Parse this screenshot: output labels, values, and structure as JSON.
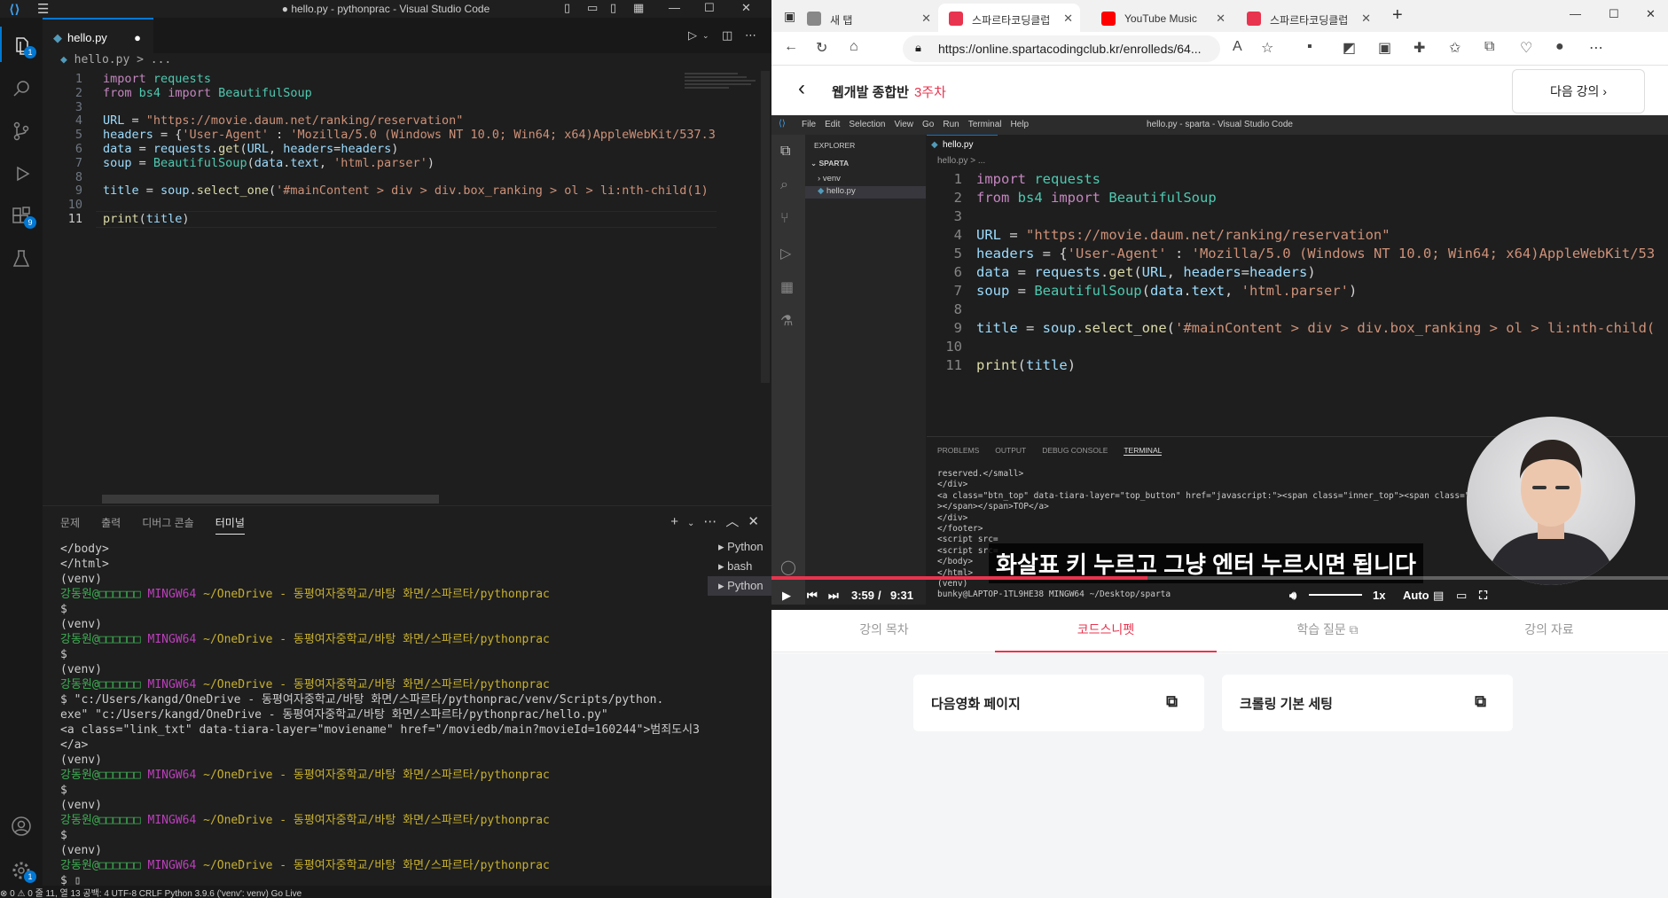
{
  "vscode": {
    "window_title": "● hello.py - pythonprac - Visual Studio Code",
    "badges": {
      "explorer": "1",
      "extensions": "9",
      "settings": "1"
    },
    "tab": {
      "label": "hello.py",
      "modified_dot": "●"
    },
    "breadcrumb": "hello.py > ...",
    "line_numbers": [
      "1",
      "2",
      "3",
      "4",
      "5",
      "6",
      "7",
      "8",
      "9",
      "10",
      "11"
    ],
    "current_line": "11",
    "code": [
      [
        {
          "t": "import",
          "c": "kw"
        },
        {
          "t": " "
        },
        {
          "t": "requests",
          "c": "mod"
        }
      ],
      [
        {
          "t": "from",
          "c": "kw"
        },
        {
          "t": " "
        },
        {
          "t": "bs4",
          "c": "mod"
        },
        {
          "t": " "
        },
        {
          "t": "import",
          "c": "kw"
        },
        {
          "t": " "
        },
        {
          "t": "BeautifulSoup",
          "c": "mod"
        }
      ],
      [],
      [
        {
          "t": "URL",
          "c": "var"
        },
        {
          "t": " = "
        },
        {
          "t": "\"https://movie.daum.net/ranking/reservation\"",
          "c": "str"
        }
      ],
      [
        {
          "t": "headers",
          "c": "var"
        },
        {
          "t": " = {"
        },
        {
          "t": "'User-Agent'",
          "c": "str"
        },
        {
          "t": " : "
        },
        {
          "t": "'Mozilla/5.0 (Windows NT 10.0; Win64; x64)AppleWebKit/537.3",
          "c": "str"
        }
      ],
      [
        {
          "t": "data",
          "c": "var"
        },
        {
          "t": " = "
        },
        {
          "t": "requests",
          "c": "var"
        },
        {
          "t": "."
        },
        {
          "t": "get",
          "c": "fn"
        },
        {
          "t": "("
        },
        {
          "t": "URL",
          "c": "var"
        },
        {
          "t": ", "
        },
        {
          "t": "headers",
          "c": "var"
        },
        {
          "t": "="
        },
        {
          "t": "headers",
          "c": "var"
        },
        {
          "t": ")"
        }
      ],
      [
        {
          "t": "soup",
          "c": "var"
        },
        {
          "t": " = "
        },
        {
          "t": "BeautifulSoup",
          "c": "mod"
        },
        {
          "t": "("
        },
        {
          "t": "data",
          "c": "var"
        },
        {
          "t": "."
        },
        {
          "t": "text",
          "c": "var"
        },
        {
          "t": ", "
        },
        {
          "t": "'html.parser'",
          "c": "str"
        },
        {
          "t": ")"
        }
      ],
      [],
      [
        {
          "t": "title",
          "c": "var"
        },
        {
          "t": " = "
        },
        {
          "t": "soup",
          "c": "var"
        },
        {
          "t": "."
        },
        {
          "t": "select_one",
          "c": "fn"
        },
        {
          "t": "("
        },
        {
          "t": "'#mainContent > div > div.box_ranking > ol > li:nth-child(1)",
          "c": "str"
        }
      ],
      [],
      [
        {
          "t": "print",
          "c": "fn"
        },
        {
          "t": "("
        },
        {
          "t": "title",
          "c": "var"
        },
        {
          "t": ")"
        }
      ]
    ],
    "panel_tabs": [
      "문제",
      "출력",
      "디버그 콘솔",
      "터미널"
    ],
    "active_panel_tab": "터미널",
    "terminal_lines": [
      [
        {
          "t": "</body>"
        }
      ],
      [
        {
          "t": "</html>"
        }
      ],
      [
        {
          "t": "(venv)"
        }
      ],
      [
        {
          "t": "강동원@□□□□□□ ",
          "c": "u"
        },
        {
          "t": "MINGW64 ",
          "c": "h"
        },
        {
          "t": "~/OneDrive - 동평여자중학교/바탕 화면/스파르타/pythonprac",
          "c": "p"
        }
      ],
      [
        {
          "t": "$"
        }
      ],
      [
        {
          "t": "(venv)"
        }
      ],
      [
        {
          "t": "강동원@□□□□□□ ",
          "c": "u"
        },
        {
          "t": "MINGW64 ",
          "c": "h"
        },
        {
          "t": "~/OneDrive - 동평여자중학교/바탕 화면/스파르타/pythonprac",
          "c": "p"
        }
      ],
      [
        {
          "t": "$"
        }
      ],
      [
        {
          "t": "(venv)"
        }
      ],
      [
        {
          "t": "강동원@□□□□□□ ",
          "c": "u"
        },
        {
          "t": "MINGW64 ",
          "c": "h"
        },
        {
          "t": "~/OneDrive - 동평여자중학교/바탕 화면/스파르타/pythonprac",
          "c": "p"
        }
      ],
      [
        {
          "t": "$ \"c:/Users/kangd/OneDrive - 동평여자중학교/바탕 화면/스파르타/pythonprac/venv/Scripts/python."
        }
      ],
      [
        {
          "t": "exe\" \"c:/Users/kangd/OneDrive - 동평여자중학교/바탕 화면/스파르타/pythonprac/hello.py\""
        }
      ],
      [
        {
          "t": "<a class=\"link_txt\" data-tiara-layer=\"moviename\" href=\"/moviedb/main?movieId=160244\">범죄도시3"
        }
      ],
      [
        {
          "t": "</a>"
        }
      ],
      [
        {
          "t": "(venv)"
        }
      ],
      [
        {
          "t": "강동원@□□□□□□ ",
          "c": "u"
        },
        {
          "t": "MINGW64 ",
          "c": "h"
        },
        {
          "t": "~/OneDrive - 동평여자중학교/바탕 화면/스파르타/pythonprac",
          "c": "p"
        }
      ],
      [
        {
          "t": "$"
        }
      ],
      [
        {
          "t": "(venv)"
        }
      ],
      [
        {
          "t": "강동원@□□□□□□ ",
          "c": "u"
        },
        {
          "t": "MINGW64 ",
          "c": "h"
        },
        {
          "t": "~/OneDrive - 동평여자중학교/바탕 화면/스파르타/pythonprac",
          "c": "p"
        }
      ],
      [
        {
          "t": "$"
        }
      ],
      [
        {
          "t": "(venv)"
        }
      ],
      [
        {
          "t": "강동원@□□□□□□ ",
          "c": "u"
        },
        {
          "t": "MINGW64 ",
          "c": "h"
        },
        {
          "t": "~/OneDrive - 동평여자중학교/바탕 화면/스파르타/pythonprac",
          "c": "p"
        }
      ],
      [
        {
          "t": "$ ▯"
        }
      ]
    ],
    "terminal_list": [
      "Python",
      "bash",
      "Python"
    ],
    "status_bar": "⊗ 0 ⚠ 0     줄 11, 열 13   공백: 4   UTF-8   CRLF   Python   3.9.6 ('venv': venv)   Go Live"
  },
  "browser": {
    "tabs": [
      {
        "label": "새 탭",
        "icon_color": "#888888"
      },
      {
        "label": "스파르타코딩클럽",
        "icon_color": "#e8344e"
      },
      {
        "label": "YouTube Music",
        "icon_color": "#ff0000"
      },
      {
        "label": "스파르타코딩클럽",
        "icon_color": "#e8344e"
      }
    ],
    "url": "https://online.spartacodingclub.kr/enrolleds/64...",
    "course_title": "웹개발 종합반",
    "course_week": "3주차",
    "next_lesson": "다음 강의",
    "inner_vscode": {
      "title": "hello.py - sparta - Visual Studio Code",
      "menu": [
        "File",
        "Edit",
        "Selection",
        "View",
        "Go",
        "Run",
        "Terminal",
        "Help"
      ],
      "explorer_title": "EXPLORER",
      "project": "SPARTA",
      "tree": [
        "venv",
        "hello.py"
      ],
      "tab": "hello.py",
      "breadcrumb": "hello.py > ...",
      "line_numbers": [
        "1",
        "2",
        "3",
        "4",
        "5",
        "6",
        "7",
        "8",
        "9",
        "10",
        "11"
      ],
      "code": [
        [
          {
            "t": "import",
            "c": "kw"
          },
          {
            "t": " "
          },
          {
            "t": "requests",
            "c": "mod"
          }
        ],
        [
          {
            "t": "from",
            "c": "kw"
          },
          {
            "t": " "
          },
          {
            "t": "bs4",
            "c": "mod"
          },
          {
            "t": " "
          },
          {
            "t": "import",
            "c": "kw"
          },
          {
            "t": " "
          },
          {
            "t": "BeautifulSoup",
            "c": "mod"
          }
        ],
        [],
        [
          {
            "t": "URL",
            "c": "var"
          },
          {
            "t": " = "
          },
          {
            "t": "\"https://movie.daum.net/ranking/reservation\"",
            "c": "str"
          }
        ],
        [
          {
            "t": "headers",
            "c": "var"
          },
          {
            "t": " = {"
          },
          {
            "t": "'User-Agent'",
            "c": "str"
          },
          {
            "t": " : "
          },
          {
            "t": "'Mozilla/5.0 (Windows NT 10.0; Win64; x64)AppleWebKit/53",
            "c": "str"
          }
        ],
        [
          {
            "t": "data",
            "c": "var"
          },
          {
            "t": " = "
          },
          {
            "t": "requests",
            "c": "var"
          },
          {
            "t": "."
          },
          {
            "t": "get",
            "c": "fn"
          },
          {
            "t": "("
          },
          {
            "t": "URL",
            "c": "var"
          },
          {
            "t": ", "
          },
          {
            "t": "headers",
            "c": "var"
          },
          {
            "t": "="
          },
          {
            "t": "headers",
            "c": "var"
          },
          {
            "t": ")"
          }
        ],
        [
          {
            "t": "soup",
            "c": "var"
          },
          {
            "t": " = "
          },
          {
            "t": "BeautifulSoup",
            "c": "mod"
          },
          {
            "t": "("
          },
          {
            "t": "data",
            "c": "var"
          },
          {
            "t": "."
          },
          {
            "t": "text",
            "c": "var"
          },
          {
            "t": ", "
          },
          {
            "t": "'html.parser'",
            "c": "str"
          },
          {
            "t": ")"
          }
        ],
        [],
        [
          {
            "t": "title",
            "c": "var"
          },
          {
            "t": " = "
          },
          {
            "t": "soup",
            "c": "var"
          },
          {
            "t": "."
          },
          {
            "t": "select_one",
            "c": "fn"
          },
          {
            "t": "("
          },
          {
            "t": "'#mainContent > div > div.box_ranking > ol > li:nth-child(",
            "c": "str"
          }
        ],
        [],
        [
          {
            "t": "print",
            "c": "fn"
          },
          {
            "t": "("
          },
          {
            "t": "title",
            "c": "var"
          },
          {
            "t": ")"
          }
        ]
      ],
      "panel_tabs": [
        "PROBLEMS",
        "OUTPUT",
        "DEBUG CONSOLE",
        "TERMINAL"
      ],
      "terminal": "reserved.</small>\n</div>\n<a class=\"btn_top\" data-tiara-layer=\"top_button\" href=\"javascript:\"><span class=\"inner_top\"><span class=\"\n></span></span>TOP</a>\n</div>\n</footer>\n<script src=\n<script src=\n</body>\n</html>\n(venv)\nbunky@LAPTOP-1TL9HE38 MINGW64 ~/Desktop/sparta"
    },
    "caption": "화살표 키 누르고 그냥 엔터 누르시면 됩니다",
    "player": {
      "current_time": "3:59",
      "separator": "/",
      "duration": "9:31",
      "speed": "1x",
      "quality": "Auto",
      "progress": 0.419
    },
    "lesson_tabs": [
      "강의 목차",
      "코드스니펫",
      "학습 질문",
      "강의 자료"
    ],
    "active_lesson_tab": "코드스니펫",
    "snippets": [
      "다음영화 페이지",
      "크롤링 기본 세팅"
    ]
  }
}
